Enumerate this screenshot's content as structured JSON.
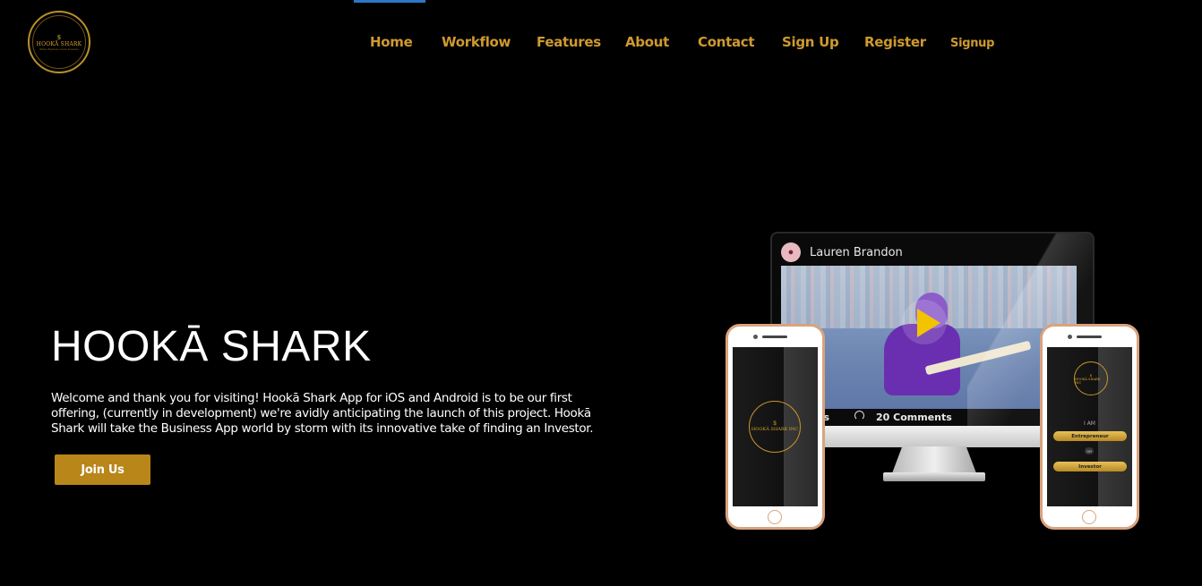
{
  "logo": {
    "symbol": "$",
    "name": "HOOKĀ SHARK",
    "tagline": "Where Business meets Investors",
    "icon": "brand-logo-circle"
  },
  "nav": {
    "items": [
      {
        "label": "Home"
      },
      {
        "label": "Workflow"
      },
      {
        "label": "Features"
      },
      {
        "label": "About"
      },
      {
        "label": "Contact"
      },
      {
        "label": "Sign Up"
      },
      {
        "label": "Register"
      },
      {
        "label": "Signup"
      }
    ]
  },
  "hero": {
    "title": "HOOKĀ SHARK",
    "description": "Welcome and thank you for visiting! Hookā Shark App for iOS and Android is to be our first offering, (currently in development) we're avidly anticipating the launch of this project. Hookā Shark will take the Business App world by storm with its innovative take of finding an Investor.",
    "cta_label": "Join Us"
  },
  "mockup": {
    "monitor": {
      "user_name": "Lauren Brandon",
      "likes_label": "es",
      "comments_label": "20 Comments",
      "play_icon": "play-icon"
    },
    "phone_left": {
      "logo_symbol": "$",
      "logo_name": "HOOKĀ SHARK INC"
    },
    "phone_right": {
      "logo_symbol": "$",
      "logo_name": "HOOKĀ SHARK INC",
      "prompt": "I AM",
      "option_1": "Entrepreneur",
      "or_label": "OR",
      "option_2": "Investor"
    }
  },
  "colors": {
    "background": "#000000",
    "nav_link": "#cf9a2e",
    "cta": "#b88619",
    "active_indicator": "#2b77c9",
    "phone_frame": "#d9a37c"
  }
}
